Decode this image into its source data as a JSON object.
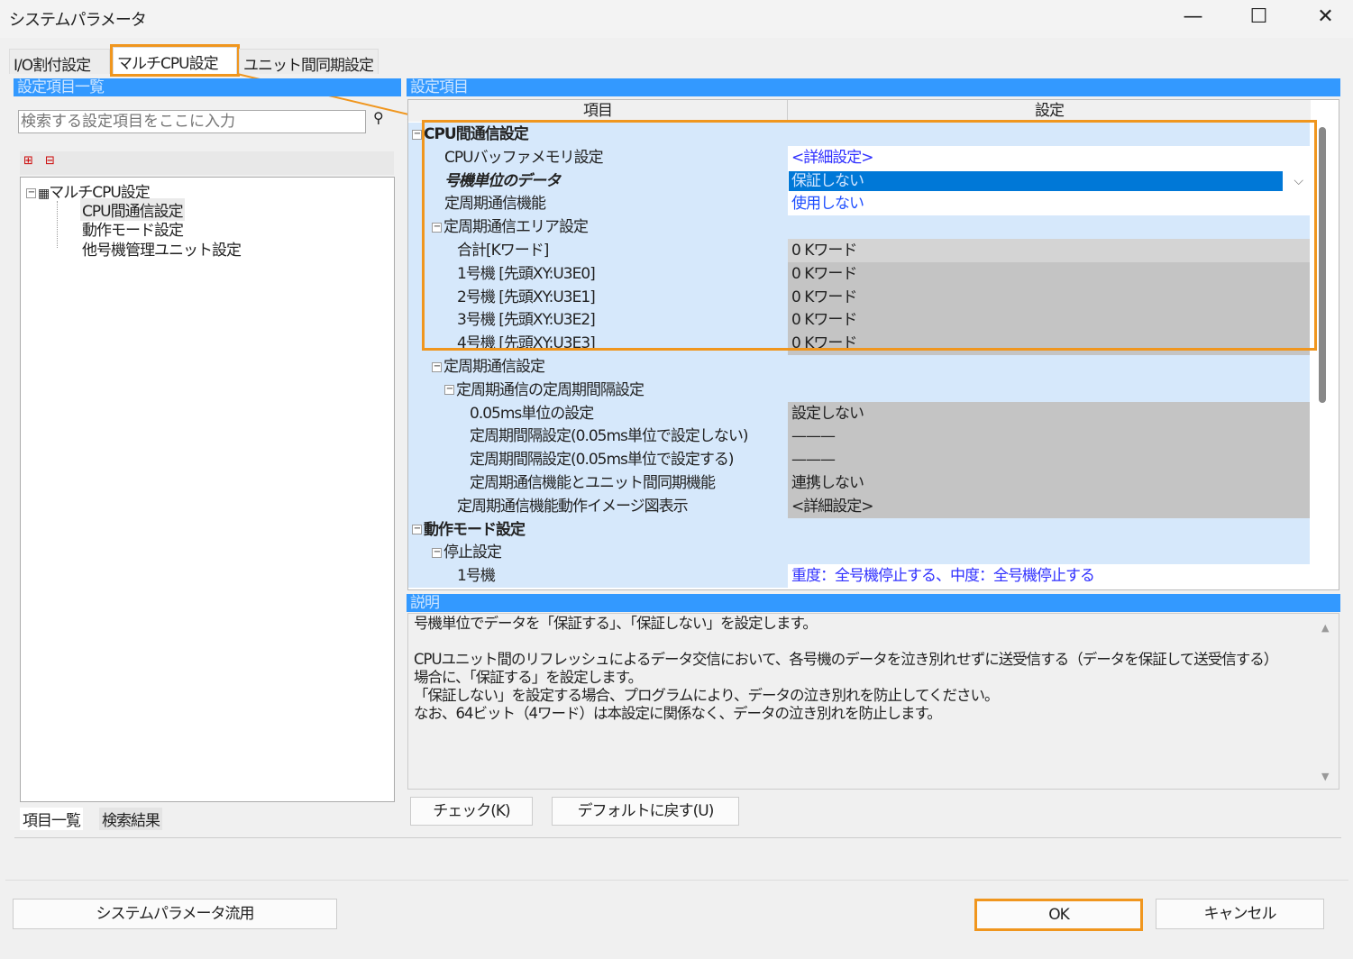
{
  "window": {
    "title": "システムパラメータ",
    "minimize": "—",
    "maximize": "☐",
    "close": "✕"
  },
  "tabs": [
    {
      "label": "I/O割付設定"
    },
    {
      "label": "マルチCPU設定",
      "active": true
    },
    {
      "label": "ユニット間同期設定"
    }
  ],
  "left": {
    "header": "設定項目一覧",
    "search_placeholder": "検索する設定項目をここに入力",
    "search_icon": "binoculars-icon",
    "tree": {
      "root": "マルチCPU設定",
      "children": [
        "CPU間通信設定",
        "動作モード設定",
        "他号機管理ユニット設定"
      ],
      "selected": "CPU間通信設定"
    },
    "bottom_tabs": [
      "項目一覧",
      "検索結果"
    ]
  },
  "right": {
    "header": "設定項目",
    "columns": [
      "項目",
      "設定"
    ],
    "rows": [
      {
        "label": "CPU間通信設定",
        "level": 0,
        "expander": true,
        "bold": true,
        "value": "",
        "style": "blank"
      },
      {
        "label": "CPUバッファメモリ設定",
        "level": 1,
        "value": "<詳細設定>",
        "style": "link"
      },
      {
        "label": "号機単位のデータ",
        "level": 1,
        "bold": true,
        "italic": true,
        "value": "保証しない",
        "style": "sel"
      },
      {
        "label": "定周期通信機能",
        "level": 1,
        "value": "使用しない",
        "style": "white"
      },
      {
        "label": "定周期通信エリア設定",
        "level": 1,
        "expander": true,
        "value": "",
        "style": "blank"
      },
      {
        "label": "合計[Kワード]",
        "level": 2,
        "value": "0 Kワード",
        "style": "light"
      },
      {
        "label": "1号機 [先頭XY:U3E0]",
        "level": 2,
        "value": "0 Kワード",
        "style": "dark"
      },
      {
        "label": "2号機 [先頭XY:U3E1]",
        "level": 2,
        "value": "0 Kワード",
        "style": "dark"
      },
      {
        "label": "3号機 [先頭XY:U3E2]",
        "level": 2,
        "value": "0 Kワード",
        "style": "dark"
      },
      {
        "label": "4号機 [先頭XY:U3E3]",
        "level": 2,
        "value": "0 Kワード",
        "style": "dark"
      },
      {
        "label": "定周期通信設定",
        "level": 1,
        "expander": true,
        "value": "",
        "style": "blank"
      },
      {
        "label": "定周期通信の定周期間隔設定",
        "level": 2,
        "expander": true,
        "value": "",
        "style": "blank"
      },
      {
        "label": "0.05ms単位の設定",
        "level": 3,
        "value": "設定しない",
        "style": "dark"
      },
      {
        "label": "定周期間隔設定(0.05ms単位で設定しない)",
        "level": 3,
        "value": "———",
        "style": "dark"
      },
      {
        "label": "定周期間隔設定(0.05ms単位で設定する)",
        "level": 3,
        "value": "———",
        "style": "dark"
      },
      {
        "label": "定周期通信機能とユニット間同期機能",
        "level": 3,
        "value": "連携しない",
        "style": "dark"
      },
      {
        "label": "定周期通信機能動作イメージ図表示",
        "level": 2,
        "value": "<詳細設定>",
        "style": "dark"
      },
      {
        "label": "動作モード設定",
        "level": 0,
        "expander": true,
        "bold": true,
        "value": "",
        "style": "blank"
      },
      {
        "label": "停止設定",
        "level": 1,
        "expander": true,
        "value": "",
        "style": "blank"
      },
      {
        "label": "1号機",
        "level": 2,
        "value": "重度：全号機停止する、中度：全号機停止する",
        "style": "link"
      }
    ]
  },
  "description": {
    "header": "説明",
    "lines": [
      "号機単位でデータを「保証する」、「保証しない」を設定します。",
      "",
      "CPUユニット間のリフレッシュによるデータ交信において、各号機のデータを泣き別れせずに送受信する（データを保証して送受信する）",
      "場合に、「保証する」を設定します。",
      "「保証しない」を設定する場合、プログラムにより、データの泣き別れを防止してください。",
      "なお、64ビット（4ワード）は本設定に関係なく、データの泣き別れを防止します。"
    ]
  },
  "buttons": {
    "check": "チェック(K)",
    "default": "デフォルトに戻す(U)",
    "system_param": "システムパラメータ流用",
    "ok": "OK",
    "cancel": "キャンセル"
  },
  "colors": {
    "highlight": "#f0961e",
    "header_blue": "#3399ff",
    "selection": "#0078d7"
  }
}
